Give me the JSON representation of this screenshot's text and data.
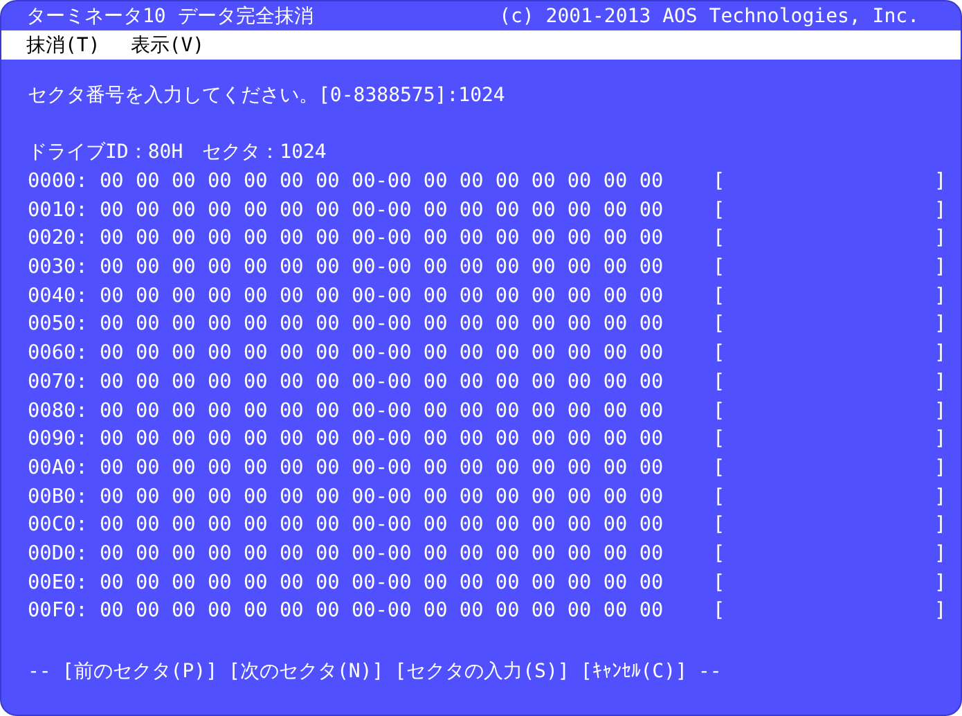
{
  "window": {
    "title": "ターミネータ10 データ完全抹消",
    "copyright": "(c) 2001-2013 AOS Technologies, Inc."
  },
  "menu": [
    {
      "label": "抹消(T)"
    },
    {
      "label": "表示(V)"
    }
  ],
  "prompt": "セクタ番号を入力してください。[0-8388575]:1024",
  "drive_info": "ドライブID：80H　セクタ：1024",
  "rows": [
    {
      "offset": "0000:",
      "hex": "00 00 00 00 00 00 00 00-00 00 00 00 00 00 00 00",
      "open": "[",
      "close": "]"
    },
    {
      "offset": "0010:",
      "hex": "00 00 00 00 00 00 00 00-00 00 00 00 00 00 00 00",
      "open": "[",
      "close": "]"
    },
    {
      "offset": "0020:",
      "hex": "00 00 00 00 00 00 00 00-00 00 00 00 00 00 00 00",
      "open": "[",
      "close": "]"
    },
    {
      "offset": "0030:",
      "hex": "00 00 00 00 00 00 00 00-00 00 00 00 00 00 00 00",
      "open": "[",
      "close": "]"
    },
    {
      "offset": "0040:",
      "hex": "00 00 00 00 00 00 00 00-00 00 00 00 00 00 00 00",
      "open": "[",
      "close": "]"
    },
    {
      "offset": "0050:",
      "hex": "00 00 00 00 00 00 00 00-00 00 00 00 00 00 00 00",
      "open": "[",
      "close": "]"
    },
    {
      "offset": "0060:",
      "hex": "00 00 00 00 00 00 00 00-00 00 00 00 00 00 00 00",
      "open": "[",
      "close": "]"
    },
    {
      "offset": "0070:",
      "hex": "00 00 00 00 00 00 00 00-00 00 00 00 00 00 00 00",
      "open": "[",
      "close": "]"
    },
    {
      "offset": "0080:",
      "hex": "00 00 00 00 00 00 00 00-00 00 00 00 00 00 00 00",
      "open": "[",
      "close": "]"
    },
    {
      "offset": "0090:",
      "hex": "00 00 00 00 00 00 00 00-00 00 00 00 00 00 00 00",
      "open": "[",
      "close": "]"
    },
    {
      "offset": "00A0:",
      "hex": "00 00 00 00 00 00 00 00-00 00 00 00 00 00 00 00",
      "open": "[",
      "close": "]"
    },
    {
      "offset": "00B0:",
      "hex": "00 00 00 00 00 00 00 00-00 00 00 00 00 00 00 00",
      "open": "[",
      "close": "]"
    },
    {
      "offset": "00C0:",
      "hex": "00 00 00 00 00 00 00 00-00 00 00 00 00 00 00 00",
      "open": "[",
      "close": "]"
    },
    {
      "offset": "00D0:",
      "hex": "00 00 00 00 00 00 00 00-00 00 00 00 00 00 00 00",
      "open": "[",
      "close": "]"
    },
    {
      "offset": "00E0:",
      "hex": "00 00 00 00 00 00 00 00-00 00 00 00 00 00 00 00",
      "open": "[",
      "close": "]"
    },
    {
      "offset": "00F0:",
      "hex": "00 00 00 00 00 00 00 00-00 00 00 00 00 00 00 00",
      "open": "[",
      "close": "]"
    }
  ],
  "footer": {
    "lead": "--",
    "actions": [
      {
        "label": "[前のセクタ(P)]"
      },
      {
        "label": "[次のセクタ(N)]"
      },
      {
        "label": "[セクタの入力(S)]"
      },
      {
        "label": "[ｷｬﾝｾﾙ(C)]"
      }
    ],
    "trail": "--"
  }
}
